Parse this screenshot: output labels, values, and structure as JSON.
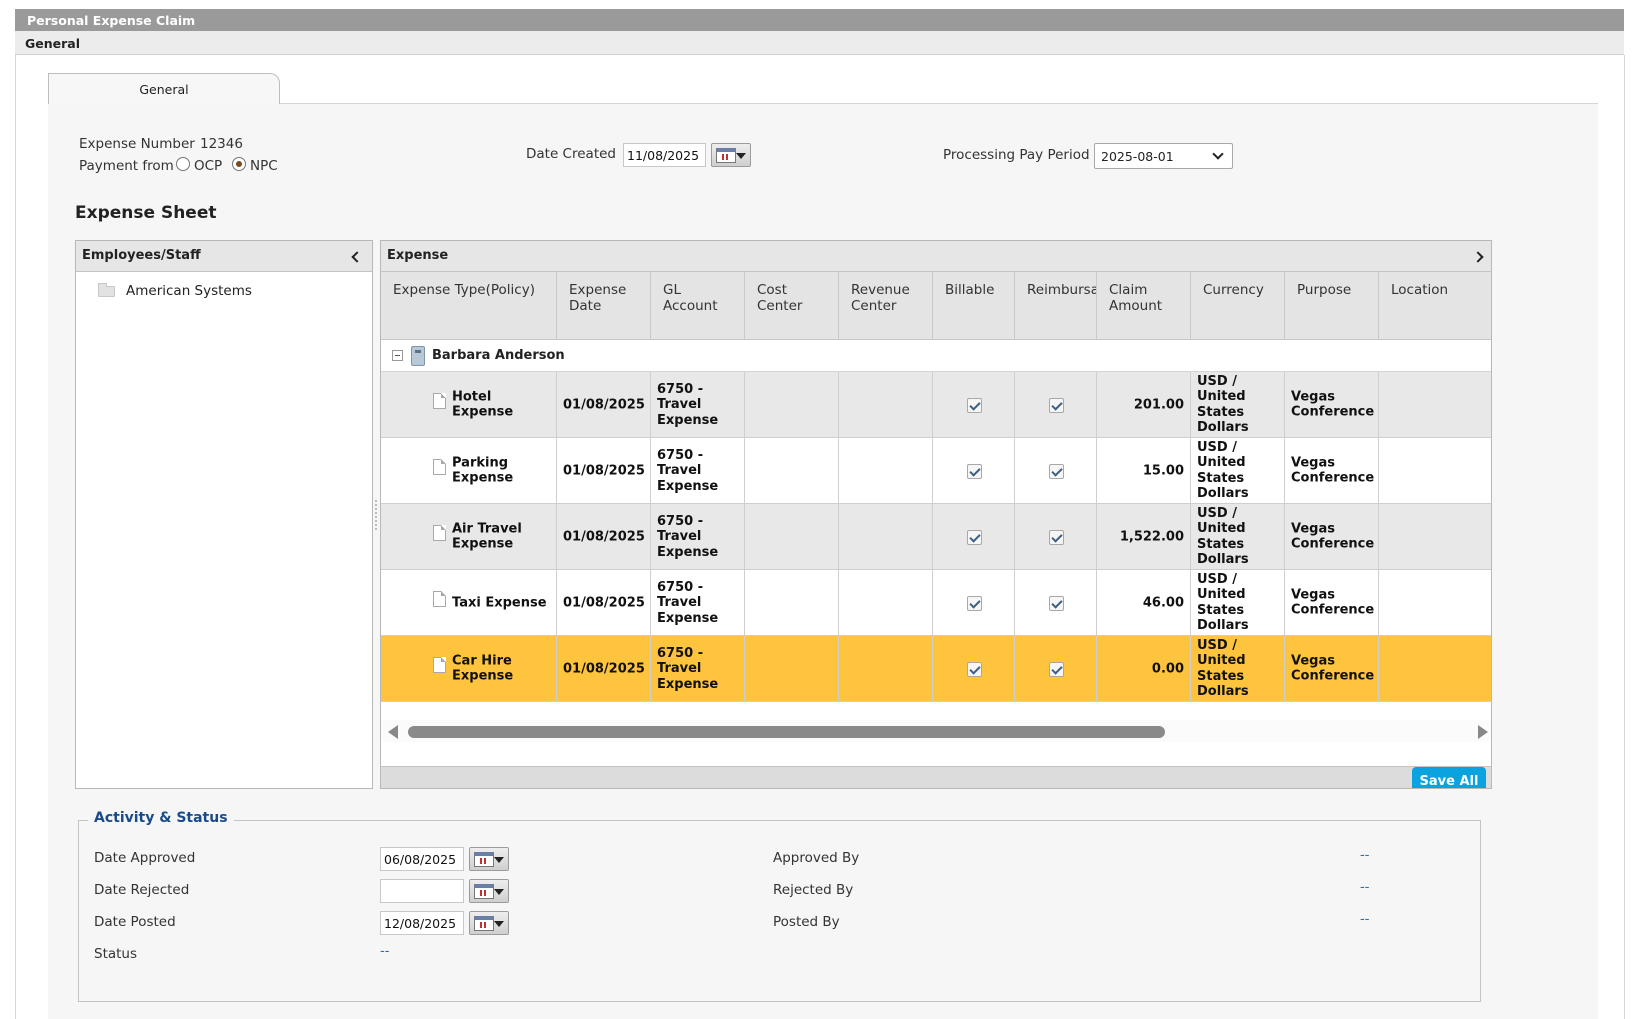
{
  "window": {
    "title": "Personal Expense Claim",
    "section": "General"
  },
  "tabs": [
    {
      "label": "General"
    }
  ],
  "form": {
    "expense_number_label": "Expense Number",
    "expense_number": "12346",
    "payment_from_label": "Payment from",
    "payment_options": [
      {
        "label": "OCP",
        "selected": false
      },
      {
        "label": "NPC",
        "selected": true
      }
    ],
    "date_created_label": "Date Created",
    "date_created": "11/08/2025",
    "pay_period_label": "Processing Pay Period",
    "pay_period": "2025-08-01"
  },
  "sheet": {
    "title": "Expense Sheet",
    "employees_header": "Employees/Staff",
    "employees": [
      "American Systems"
    ],
    "grid_header": "Expense",
    "columns": [
      "Expense Type(Policy)",
      "Expense Date",
      "GL Account",
      "Cost Center",
      "Revenue Center",
      "Billable",
      "Reimbursable",
      "Claim Amount",
      "Currency",
      "Purpose",
      "Location"
    ],
    "group": "Barbara Anderson",
    "rows": [
      {
        "type": "Hotel Expense",
        "date": "01/08/2025",
        "gl": "6750 -\nTravel\nExpense",
        "cost_center": "",
        "revenue_center": "",
        "billable": true,
        "reimbursable": true,
        "amount": "201.00",
        "currency": "USD /\nUnited\nStates\nDollars",
        "purpose": "Vegas\nConference",
        "location": "",
        "selected": false
      },
      {
        "type": "Parking Expense",
        "date": "01/08/2025",
        "gl": "6750 -\nTravel\nExpense",
        "cost_center": "",
        "revenue_center": "",
        "billable": true,
        "reimbursable": true,
        "amount": "15.00",
        "currency": "USD /\nUnited\nStates\nDollars",
        "purpose": "Vegas\nConference",
        "location": "",
        "selected": false
      },
      {
        "type": "Air Travel Expense",
        "date": "01/08/2025",
        "gl": "6750 -\nTravel\nExpense",
        "cost_center": "",
        "revenue_center": "",
        "billable": true,
        "reimbursable": true,
        "amount": "1,522.00",
        "currency": "USD /\nUnited\nStates\nDollars",
        "purpose": "Vegas\nConference",
        "location": "",
        "selected": false
      },
      {
        "type": "Taxi Expense",
        "date": "01/08/2025",
        "gl": "6750 -\nTravel\nExpense",
        "cost_center": "",
        "revenue_center": "",
        "billable": true,
        "reimbursable": true,
        "amount": "46.00",
        "currency": "USD /\nUnited\nStates\nDollars",
        "purpose": "Vegas\nConference",
        "location": "",
        "selected": false
      },
      {
        "type": "Car Hire Expense",
        "date": "01/08/2025",
        "gl": "6750 -\nTravel\nExpense",
        "cost_center": "",
        "revenue_center": "",
        "billable": true,
        "reimbursable": true,
        "amount": "0.00",
        "currency": "USD /\nUnited\nStates\nDollars",
        "purpose": "Vegas\nConference",
        "location": "",
        "selected": true
      }
    ],
    "save_all_label": "Save All"
  },
  "activity": {
    "title": "Activity & Status",
    "date_approved_label": "Date Approved",
    "date_approved": "06/08/2025",
    "date_rejected_label": "Date Rejected",
    "date_rejected": "",
    "date_posted_label": "Date Posted",
    "date_posted": "12/08/2025",
    "status_label": "Status",
    "status": "--",
    "approved_by_label": "Approved By",
    "approved_by": "--",
    "rejected_by_label": "Rejected By",
    "rejected_by": "--",
    "posted_by_label": "Posted By",
    "posted_by": "--"
  },
  "colors": {
    "title_bar": "#9a9a9a",
    "selected_row": "#ffc43d",
    "alt_row": "#e8e8e8",
    "save_button": "#0aa3e0",
    "legend_text": "#1a4a8a"
  }
}
